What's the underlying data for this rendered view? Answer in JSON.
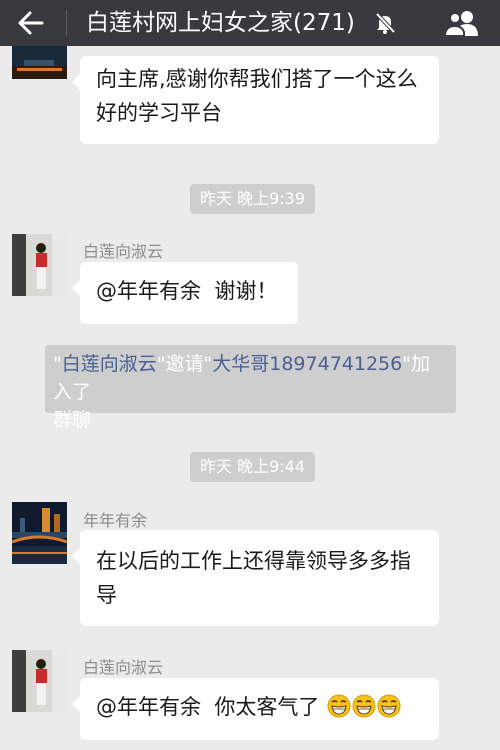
{
  "header": {
    "title": "白莲村网上妇女之家(271)",
    "icons": [
      "back-arrow-icon",
      "mute-bell-icon",
      "group-members-icon"
    ]
  },
  "messages": [
    {
      "sender": "",
      "text": "向主席,感谢你帮我们搭了一个这么好的学习平台",
      "line1": "向主席,感谢你帮我们搭了一个这么",
      "line2": "好的学习平台"
    },
    {
      "timestamp": "昨天 晚上9:39"
    },
    {
      "sender": "白莲向淑云",
      "text": "@年年有余  谢谢！"
    },
    {
      "system": {
        "quote1": "\"",
        "inviter": "白莲向淑云",
        "mid": "\"邀请\"",
        "invitee": "大华哥18974741256",
        "tail": "\"加入了",
        "tail2": "群聊"
      }
    },
    {
      "timestamp": "昨天 晚上9:44"
    },
    {
      "sender": "年年有余",
      "text": "在以后的工作上还得靠领导多多指导",
      "line1": "在以后的工作上还得靠领导多多指",
      "line2": "导"
    },
    {
      "sender": "白莲向淑云",
      "text": "@年年有余  你太客气了",
      "emoji": "grin-emoji"
    }
  ],
  "colors": {
    "header_bg": "#393a3f",
    "chat_bg": "#ebebeb",
    "bubble_bg": "#ffffff",
    "system_bg": "#cecece",
    "name_link": "#4b5f93"
  }
}
